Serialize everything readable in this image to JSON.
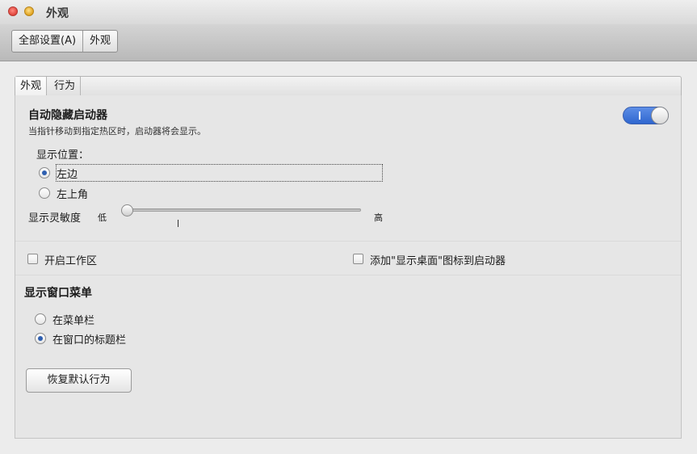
{
  "window": {
    "title": "外观"
  },
  "toolbar": {
    "breadcrumbs": [
      "全部设置(A)",
      "外观"
    ]
  },
  "tabs": [
    "外观",
    "行为"
  ],
  "autohide": {
    "title": "自动隐藏启动器",
    "description": "当指针移动到指定热区时，启动器将会显示。",
    "enabled": true,
    "position_label": "显示位置：",
    "positions": [
      "左边",
      "左上角"
    ],
    "selected_position": "左边",
    "sensitivity_label": "显示灵敏度",
    "sensitivity_low": "低",
    "sensitivity_high": "高",
    "sensitivity_level": 0
  },
  "checkboxes": {
    "workspaces": {
      "label": "开启工作区",
      "checked": false
    },
    "show_desktop": {
      "label": "添加\"显示桌面\"图标到启动器",
      "checked": false
    }
  },
  "window_menu": {
    "title": "显示窗口菜单",
    "options": [
      "在菜单栏",
      "在窗口的标题栏"
    ],
    "selected": "在窗口的标题栏"
  },
  "restore_button": "恢复默认行为",
  "colors": {
    "accent": "#2f66cf"
  }
}
